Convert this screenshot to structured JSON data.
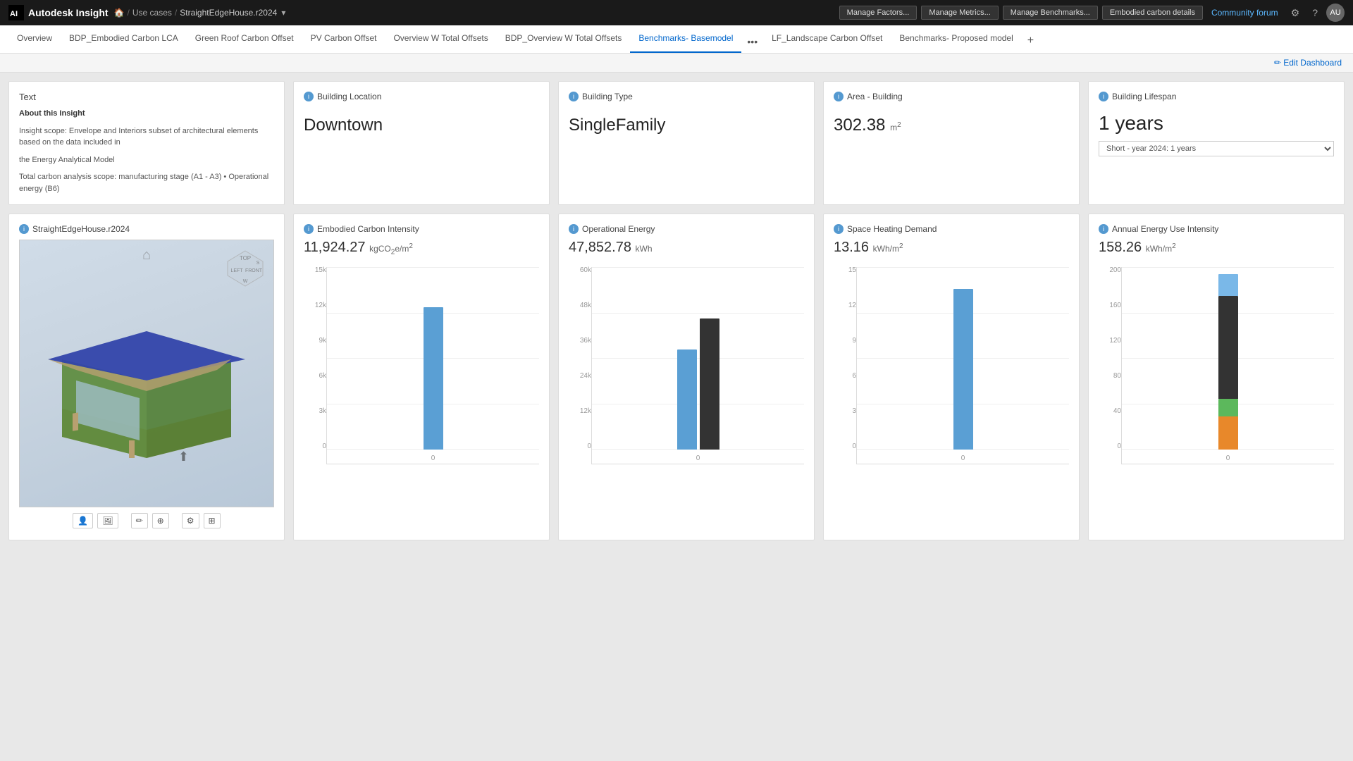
{
  "topnav": {
    "brand": "Autodesk Insight",
    "home_icon": "🏠",
    "use_cases_label": "Use cases",
    "breadcrumb_sep": "/",
    "current_project": "StraightEdgeHouse.r2024",
    "chevron": "▾",
    "manage_factors": "Manage Factors...",
    "manage_metrics": "Manage Metrics...",
    "manage_benchmarks": "Manage Benchmarks...",
    "embodied_carbon": "Embodied carbon details",
    "community_forum": "Community forum",
    "gear_icon": "⚙",
    "help_icon": "?",
    "avatar_initials": "AU"
  },
  "tabs": [
    {
      "label": "Overview",
      "active": false
    },
    {
      "label": "BDP_Embodied Carbon LCA",
      "active": false
    },
    {
      "label": "Green Roof Carbon Offset",
      "active": false
    },
    {
      "label": "PV Carbon Offset",
      "active": false
    },
    {
      "label": "Overview W Total Offsets",
      "active": false
    },
    {
      "label": "BDP_Overview W Total Offsets",
      "active": false
    },
    {
      "label": "Benchmarks- Basemodel",
      "active": true
    },
    {
      "label": "LF_Landscape Carbon Offset",
      "active": false
    },
    {
      "label": "Benchmarks- Proposed model",
      "active": false
    }
  ],
  "edit_dashboard": "✏ Edit Dashboard",
  "cards": {
    "text": {
      "title": "Text",
      "heading": "About this Insight",
      "line1": "Insight scope: Envelope and Interiors subset of architectural elements based on the data included in",
      "line2": "the Energy Analytical Model",
      "line3": "Total carbon analysis scope: manufacturing stage (A1 - A3) • Operational energy (B6)"
    },
    "location": {
      "title": "Building Location",
      "value": "Downtown"
    },
    "type": {
      "title": "Building Type",
      "value": "SingleFamily"
    },
    "area": {
      "title": "Area - Building",
      "value": "302.38",
      "unit": "m",
      "exponent": "2"
    },
    "lifespan": {
      "title": "Building Lifespan",
      "value": "1 years",
      "select_value": "Short - year 2024: 1 years"
    },
    "model": {
      "title": "StraightEdgeHouse.r2024"
    },
    "embodied": {
      "title": "Embodied Carbon Intensity",
      "value": "11,924.27",
      "unit": "kgCO",
      "unit2": "2",
      "unit3": "e/m",
      "unit4": "2",
      "y_labels": [
        "15k",
        "12k",
        "9k",
        "6k",
        "3k",
        "0"
      ],
      "bars": [
        {
          "color": "blue",
          "height_pct": 78
        }
      ]
    },
    "operational": {
      "title": "Operational Energy",
      "value": "47,852.78",
      "unit": "kWh",
      "y_labels": [
        "60k",
        "48k",
        "36k",
        "24k",
        "12k",
        "0"
      ],
      "bars": [
        {
          "color": "blue",
          "height_pct": 62
        },
        {
          "color": "dark",
          "height_pct": 80
        }
      ]
    },
    "heating": {
      "title": "Space Heating Demand",
      "value": "13.16",
      "unit": "kWh/m",
      "exponent": "2",
      "y_labels": [
        "15",
        "12",
        "9",
        "6",
        "3",
        "0"
      ],
      "bars": [
        {
          "color": "blue",
          "height_pct": 88
        }
      ]
    },
    "annual": {
      "title": "Annual Energy Use Intensity",
      "value": "158.26",
      "unit": "kWh/m",
      "exponent": "2",
      "y_labels": [
        "200",
        "160",
        "120",
        "80",
        "40",
        "0"
      ],
      "bars": [
        {
          "color": "light-blue",
          "height_pct": 12
        },
        {
          "color": "dark",
          "height_pct": 56
        },
        {
          "color": "green",
          "height_pct": 10
        },
        {
          "color": "orange",
          "height_pct": 18
        }
      ]
    }
  },
  "model_tools": [
    "👤",
    "🖼",
    "✏",
    "⊕",
    "⚙",
    "⊞"
  ]
}
